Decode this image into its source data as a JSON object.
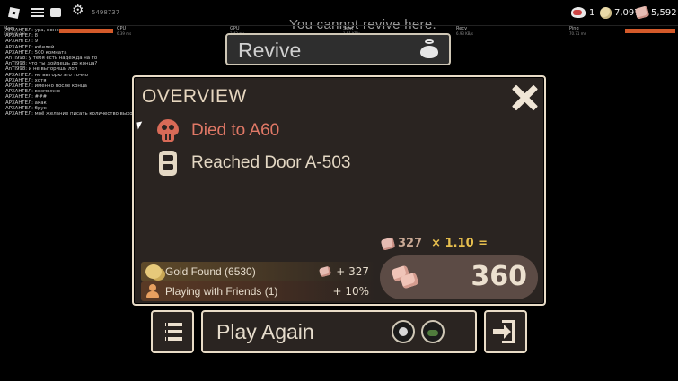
{
  "topbar": {
    "session_id": "5498737",
    "revive_hint": "You cannot revive here.",
    "currencies": [
      {
        "icon": "revive-heart-icon",
        "value": "1"
      },
      {
        "icon": "gold-coin-icon",
        "value": "7,097"
      },
      {
        "icon": "knob-icon",
        "value": "5,592"
      }
    ]
  },
  "stats": [
    {
      "label": "Mem",
      "sub": "1084.46 MB"
    },
    {
      "label": "CPU",
      "sub": "6.39 ms"
    },
    {
      "label": "GPU",
      "sub": "3.42 ms"
    },
    {
      "label": "Sent",
      "sub": "1.51 KB/s"
    },
    {
      "label": "Recv",
      "sub": "6.93 KB/s"
    },
    {
      "label": "Ping",
      "sub": "70.71 ms"
    }
  ],
  "chat": [
    "АРХАНГЕЛ: ура, ноне",
    "АРХАНГЕЛ: 8",
    "АРХАНГЕЛ: 9",
    "АРХАНГЕЛ: юбилей",
    "АРХАНГЕЛ: 500 комната",
    "AnTI998: у тебя есть надежда на то",
    "AnTI998: что ты дойдешь до конца?",
    "AnTI998: и не выгоришь лол",
    "АРХАНГЕЛ: не выгорю это точно",
    "АРХАНГЕЛ: хотя",
    "АРХАНГЕЛ: именно после конца",
    "АРХАНГЕЛ: возможно",
    "АРХАНГЕЛ: ###",
    "АРХАНГЕЛ: акак",
    "АРХАНГЕЛ: брух",
    "АРХАНГЕЛ: моё желание писать количество выходов убило меня"
  ],
  "revive": {
    "label": "Revive"
  },
  "overview": {
    "title": "OVERVIEW",
    "death_text": "Died to A60",
    "door_text": "Reached Door A-503",
    "multiplier": {
      "base": "327",
      "times": "× 1.10 =",
      "mult": "1.10"
    },
    "bonuses": [
      {
        "label": "Gold Found (6530)",
        "value": "+ 327"
      },
      {
        "label": "Playing with Friends (1)",
        "value": "+ 10%"
      }
    ],
    "total": "360"
  },
  "buttons": {
    "play_again": "Play Again"
  },
  "colors": {
    "panel_bg": "#2a2421",
    "panel_border": "#e9dcc7",
    "death_red": "#e07866",
    "multiplier_gold": "#e7bf4e"
  }
}
